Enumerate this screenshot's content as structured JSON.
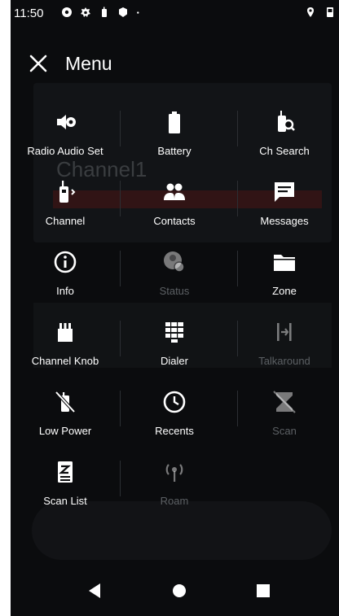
{
  "status_bar": {
    "time": "11:50",
    "left_icons": [
      "gear-icon",
      "settings-icon",
      "radio-icon",
      "shield-icon",
      "dot-icon"
    ],
    "right_icons": [
      "location-icon",
      "battery-icon"
    ]
  },
  "header": {
    "title": "Menu",
    "close_icon": "close-icon"
  },
  "menu_items": [
    {
      "label": "Radio Audio Set",
      "icon": "speaker-gear-icon",
      "enabled": true
    },
    {
      "label": "Battery",
      "icon": "battery-icon",
      "enabled": true
    },
    {
      "label": "Ch Search",
      "icon": "radio-search-icon",
      "enabled": true
    },
    {
      "label": "Channel",
      "icon": "radio-channel-icon",
      "enabled": true
    },
    {
      "label": "Contacts",
      "icon": "contacts-icon",
      "enabled": true
    },
    {
      "label": "Messages",
      "icon": "messages-icon",
      "enabled": true
    },
    {
      "label": "Info",
      "icon": "info-icon",
      "enabled": true
    },
    {
      "label": "Status",
      "icon": "status-icon",
      "enabled": false
    },
    {
      "label": "Zone",
      "icon": "folder-icon",
      "enabled": true
    },
    {
      "label": "Channel Knob",
      "icon": "knob-icon",
      "enabled": true
    },
    {
      "label": "Dialer",
      "icon": "dialpad-icon",
      "enabled": true
    },
    {
      "label": "Talkaround",
      "icon": "talkaround-icon",
      "enabled": false
    },
    {
      "label": "Low Power",
      "icon": "low-power-icon",
      "enabled": true
    },
    {
      "label": "Recents",
      "icon": "clock-icon",
      "enabled": true
    },
    {
      "label": "Scan",
      "icon": "scan-icon",
      "enabled": false
    },
    {
      "label": "Scan List",
      "icon": "scan-list-icon",
      "enabled": true
    },
    {
      "label": "Roam",
      "icon": "roam-icon",
      "enabled": false
    }
  ],
  "background": {
    "channel_text": "Channel1"
  },
  "nav_bar": {
    "buttons": [
      "back-icon",
      "home-icon",
      "recents-icon"
    ]
  },
  "colors": {
    "background": "#0b0c0e",
    "text": "#ffffff",
    "disabled_text": "#5c6064"
  }
}
